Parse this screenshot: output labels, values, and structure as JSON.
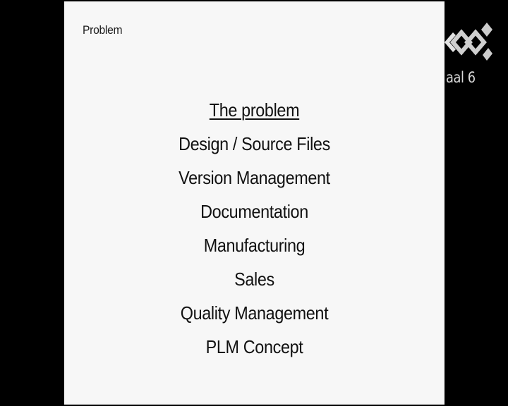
{
  "slide": {
    "title": "Problem",
    "items": [
      "The problem",
      "Design / Source Files",
      "Version Management",
      "Documentation",
      "Manufacturing",
      "Sales",
      "Quality Management",
      "PLM Concept"
    ]
  },
  "overlay": {
    "channel_label": "aal 6",
    "logo_icon": "channel-logo-icon"
  },
  "colors": {
    "background": "#000000",
    "slide": "#f7f7f7",
    "text": "#111111",
    "logo": "#d0d0d0"
  }
}
